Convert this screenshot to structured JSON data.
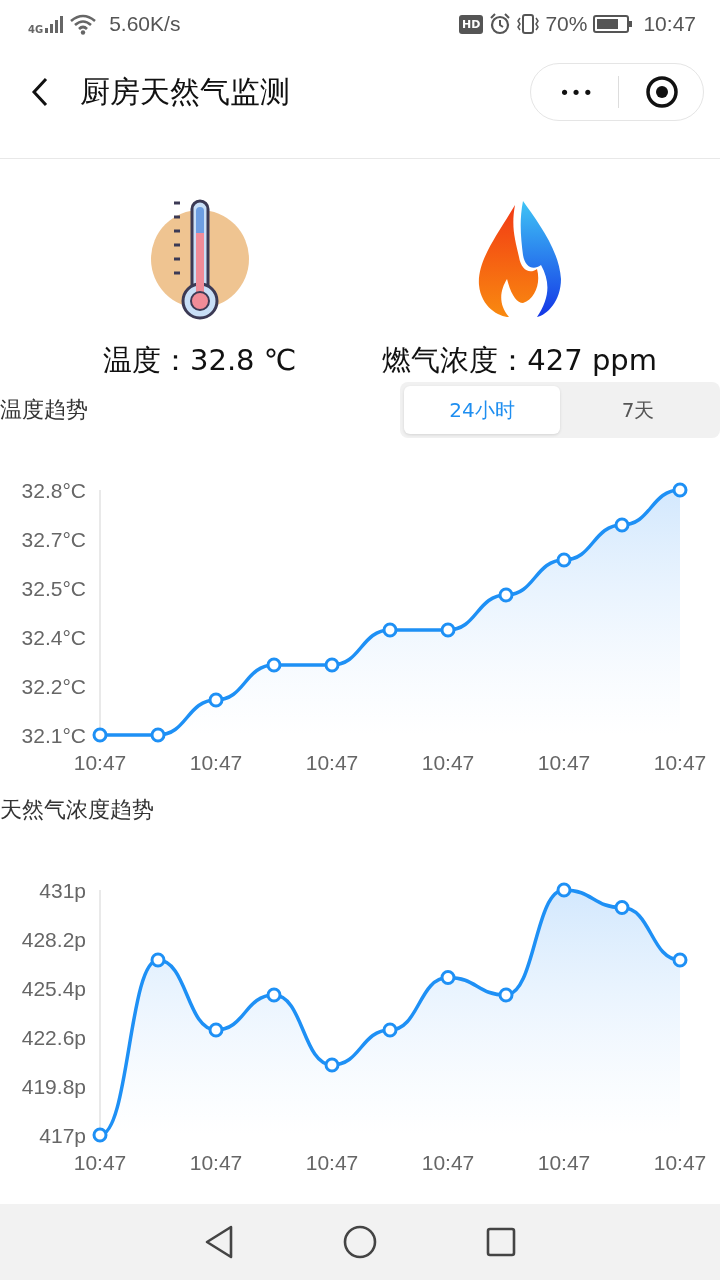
{
  "status_bar": {
    "network": "4G",
    "speed": "5.60K/s",
    "hd": "HD",
    "battery": "70%",
    "time": "10:47"
  },
  "nav": {
    "title": "厨房天然气监测",
    "more": "•••"
  },
  "readings": [
    {
      "kind": "temperature",
      "label": "温度：32.8 ℃"
    },
    {
      "kind": "gas",
      "label": "燃气浓度：427 ppm"
    }
  ],
  "sections": [
    {
      "title": "温度趋势",
      "tabs": [
        {
          "label": "24小时",
          "selected": true
        },
        {
          "label": "7天",
          "selected": false
        }
      ],
      "chart_data": {
        "type": "area",
        "categories": [
          "10:47",
          null,
          "10:47",
          null,
          "10:47",
          null,
          "10:47",
          null,
          "10:47",
          null,
          "10:47"
        ],
        "series": [
          {
            "color": "#1e90f5",
            "values": [
              32.1,
              32.1,
              32.2,
              32.3,
              32.3,
              32.4,
              32.4,
              32.5,
              32.6,
              32.7,
              32.8
            ]
          }
        ],
        "ylim": [
          32.1,
          32.8
        ],
        "yticks": [
          {
            "value": 32.1,
            "label": "32.1°C"
          },
          {
            "value": 32.24,
            "label": "32.2°C"
          },
          {
            "value": 32.38,
            "label": "32.4°C"
          },
          {
            "value": 32.52,
            "label": "32.5°C"
          },
          {
            "value": 32.66,
            "label": "32.7°C"
          },
          {
            "value": 32.8,
            "label": "32.8°C"
          }
        ]
      }
    },
    {
      "title": "天然气浓度趋势",
      "chart_data": {
        "type": "area",
        "categories": [
          "10:47",
          null,
          "10:47",
          null,
          "10:47",
          null,
          "10:47",
          null,
          "10:47",
          null,
          "10:47"
        ],
        "series": [
          {
            "color": "#1e90f5",
            "values": [
              417,
              427,
              423,
              425,
              421,
              423,
              426,
              425,
              431,
              430,
              427
            ]
          }
        ],
        "ylim": [
          417,
          431
        ],
        "yticks": [
          {
            "value": 417,
            "label": "417p"
          },
          {
            "value": 419.8,
            "label": "419.8p"
          },
          {
            "value": 422.6,
            "label": "422.6p"
          },
          {
            "value": 425.4,
            "label": "425.4p"
          },
          {
            "value": 428.2,
            "label": "428.2p"
          },
          {
            "value": 431,
            "label": "431p"
          }
        ]
      }
    }
  ]
}
